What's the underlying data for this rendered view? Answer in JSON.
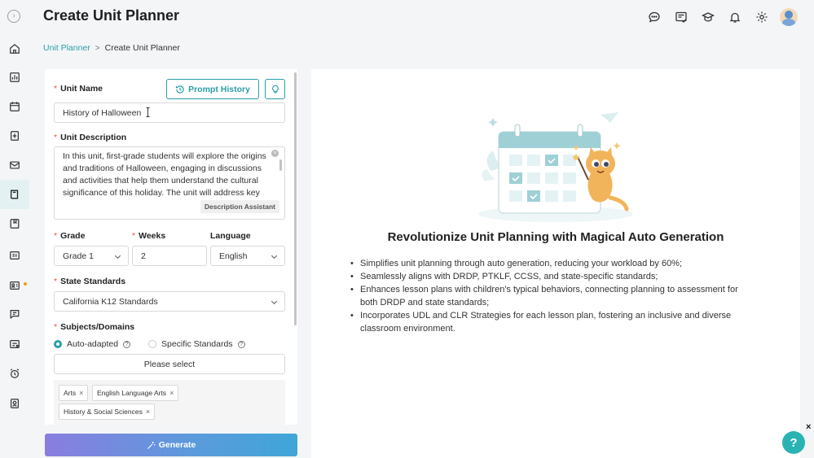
{
  "header": {
    "title": "Create Unit Planner"
  },
  "breadcrumb": {
    "parent": "Unit Planner",
    "separator": ">",
    "current": "Create Unit Planner"
  },
  "form": {
    "unit_name_label": "Unit Name",
    "unit_name_value": "History of Halloween",
    "prompt_history_label": "Prompt History",
    "unit_description_label": "Unit Description",
    "unit_description_value": "In this unit, first-grade students will explore the origins and traditions of Halloween, engaging in discussions and activities that help them understand the cultural significance of this holiday. The unit will address key",
    "description_assistant_label": "Description Assistant",
    "grade_label": "Grade",
    "grade_value": "Grade 1",
    "weeks_label": "Weeks",
    "weeks_value": "2",
    "language_label": "Language",
    "language_value": "English",
    "state_standards_label": "State Standards",
    "state_standards_value": "California K12 Standards",
    "subjects_label": "Subjects/Domains",
    "radio_auto_label": "Auto-adapted",
    "radio_specific_label": "Specific Standards",
    "please_select_label": "Please select",
    "tags": [
      "Arts",
      "English Language Arts",
      "History & Social Sciences"
    ],
    "generate_label": "Generate"
  },
  "hero": {
    "title": "Revolutionize Unit Planning with Magical Auto Generation",
    "bullets": [
      "Simplifies unit planning through auto generation, reducing your workload by 60%;",
      "Seamlessly aligns with DRDP, PTKLF, CCSS, and state-specific standards;",
      "Enhances lesson plans with children's typical behaviors, connecting planning to assessment for both DRDP and state standards;",
      "Incorporates UDL and CLR Strategies for each lesson plan, fostering an inclusive and diverse classroom environment."
    ]
  },
  "help": {
    "label": "?",
    "close": "×"
  },
  "colors": {
    "accent": "#2a9ea8",
    "required": "#e6553c",
    "sidebar_active": "#e3f1f2",
    "notification_dot": "#f39c12"
  },
  "icons": {
    "sidebar": [
      "home-icon",
      "chart-icon",
      "calendar-icon",
      "report-icon",
      "mail-icon",
      "book-icon",
      "bookmark-icon",
      "reader-icon",
      "profile-card-icon",
      "chat-icon",
      "id-card-icon",
      "alarm-icon",
      "portrait-icon"
    ],
    "header": [
      "chat-icon",
      "document-list-icon",
      "graduation-cap-icon",
      "bell-icon",
      "gear-icon",
      "avatar"
    ]
  }
}
